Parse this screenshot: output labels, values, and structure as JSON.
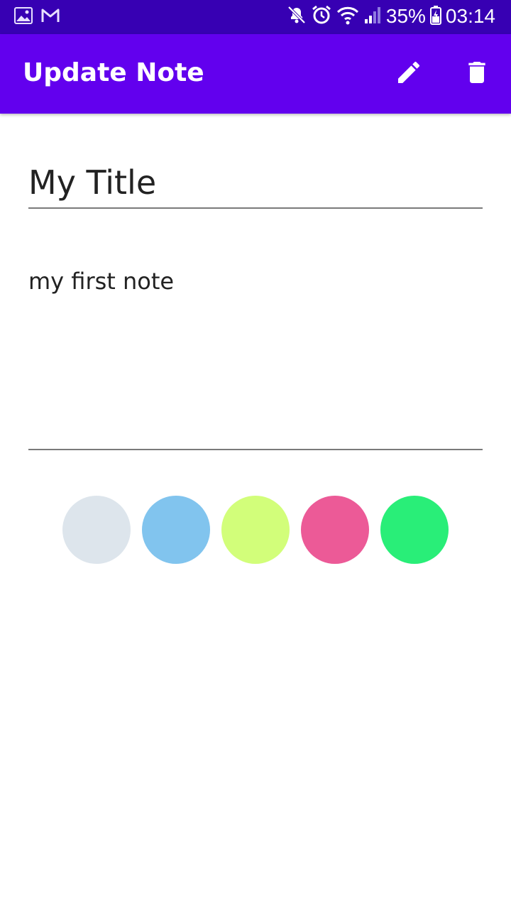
{
  "status_bar": {
    "left_icons": [
      "image-icon",
      "gmail-icon"
    ],
    "right_icons": [
      "mute-icon",
      "alarm-icon",
      "wifi-icon",
      "signal-icon"
    ],
    "battery": "35%",
    "time": "03:14",
    "background": "#3700b3"
  },
  "app_bar": {
    "title": "Update Note",
    "actions": [
      "edit-icon",
      "delete-icon"
    ],
    "background": "#6200ee"
  },
  "form": {
    "title_value": "My Title",
    "description_value": "my first note"
  },
  "color_palette": [
    {
      "name": "color-swatch-gray",
      "hex": "#dde5ec"
    },
    {
      "name": "color-swatch-blue",
      "hex": "#81c4ee"
    },
    {
      "name": "color-swatch-lime",
      "hex": "#d2fe7a"
    },
    {
      "name": "color-swatch-pink",
      "hex": "#ec5a97"
    },
    {
      "name": "color-swatch-green",
      "hex": "#29ee78"
    }
  ]
}
